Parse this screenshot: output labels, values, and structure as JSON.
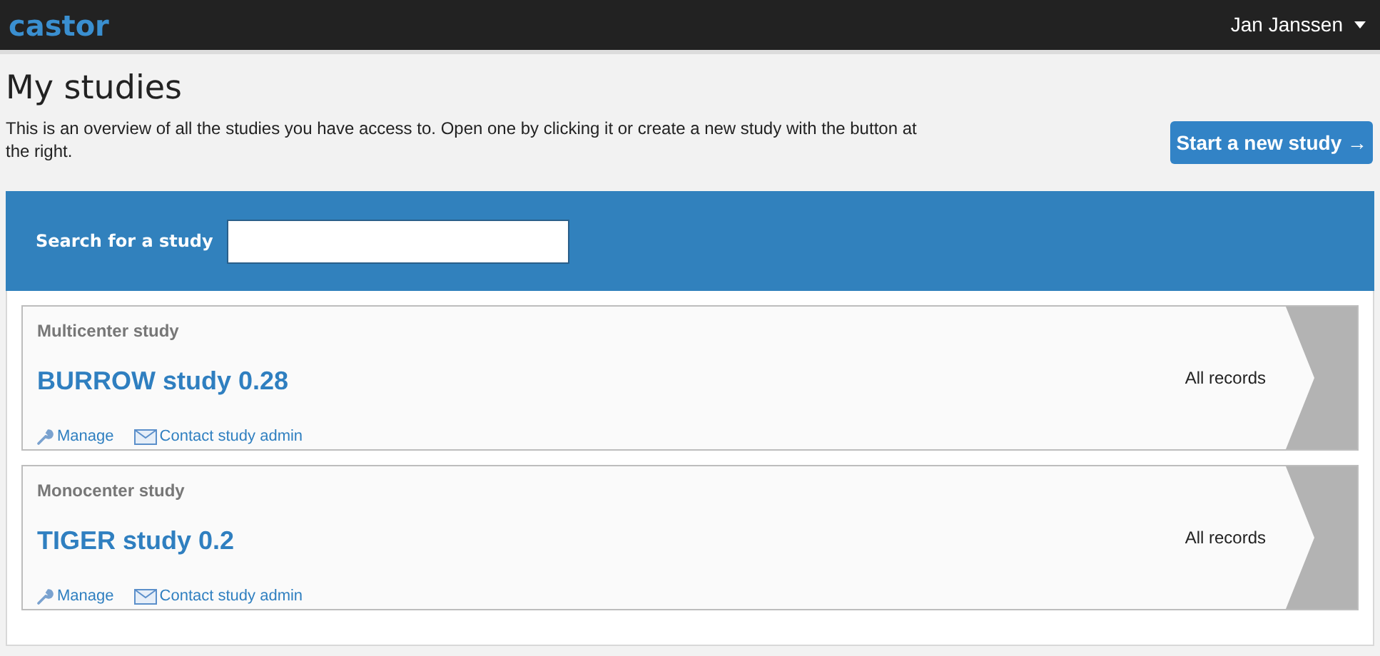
{
  "navbar": {
    "logo": "castor",
    "user": "Jan Janssen"
  },
  "page": {
    "title": "My studies",
    "intro": "This is an overview of all the studies you have access to. Open one by clicking it or create a new study with the button at the right.",
    "new_study_button": "Start a new study →"
  },
  "search": {
    "label": "Search for a study"
  },
  "studies": [
    {
      "type": "Multicenter study",
      "name": "BURROW study 0.28",
      "records": "All records",
      "links": [
        "Manage",
        "Contact study admin"
      ]
    },
    {
      "type": "Monocenter study",
      "name": "TIGER study 0.2",
      "records": "All records",
      "links": [
        "Manage",
        "Contact study admin"
      ]
    }
  ]
}
